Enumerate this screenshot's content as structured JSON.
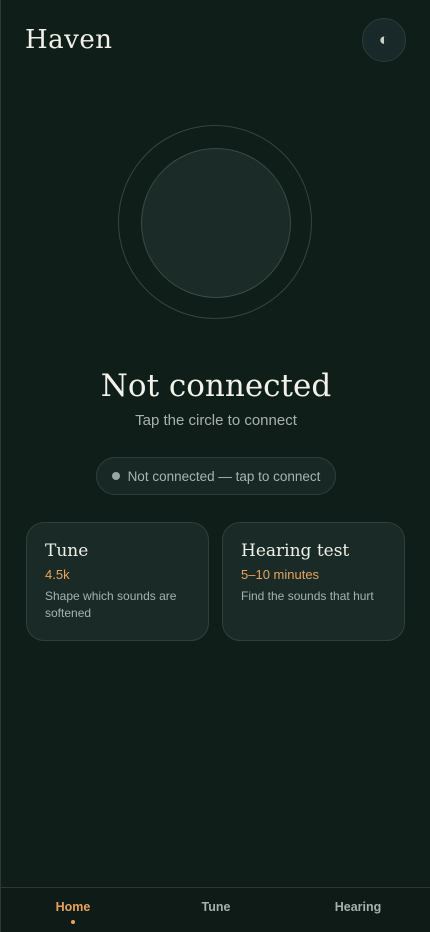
{
  "header": {
    "brand": "Haven",
    "theme_icon_glyph": "◐",
    "theme_icon": "contrast-icon"
  },
  "connection": {
    "title": "Not connected",
    "subtitle": "Tap the circle to connect",
    "pill_label": "Not connected — tap to connect"
  },
  "cards": [
    {
      "title": "Tune",
      "meta": "4.5k",
      "description": "Shape which sounds are softened"
    },
    {
      "title": "Hearing test",
      "meta": "5–10 minutes",
      "description": "Find the sounds that hurt"
    }
  ],
  "nav": {
    "items": [
      {
        "label": "Home",
        "active": true
      },
      {
        "label": "Tune",
        "active": false
      },
      {
        "label": "Hearing",
        "active": false
      }
    ]
  },
  "colors": {
    "background": "#101e1a",
    "surface": "#1a2a26",
    "accent": "#e7a35e",
    "text_primary": "#eef1e8",
    "text_secondary": "#a7b2ad"
  }
}
